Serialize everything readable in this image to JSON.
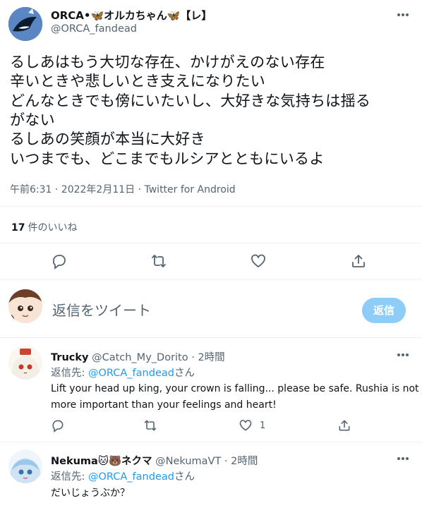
{
  "main_tweet": {
    "author_name": "ORCA•🦋オルカちゃん🦋【レ】",
    "author_handle": "@ORCA_fandead",
    "lines": [
      "るしあはもう大切な存在、かけがえのない存在",
      "辛いときや悲しいとき支えになりたい",
      "どんなときでも傍にいたいし、大好きな気持ちは揺る",
      "がない",
      "るしあの笑顔が本当に大好き",
      "いつまでも、どこまでもルシアとともにいるよ"
    ],
    "timestamp": "午前6:31 · 2022年2月11日 · Twitter for Android",
    "likes_count": "17",
    "likes_label": "件のいいね"
  },
  "actions": {
    "reply_icon": "reply-icon",
    "retweet_icon": "retweet-icon",
    "like_icon": "heart-icon",
    "share_icon": "share-icon"
  },
  "composer": {
    "placeholder": "返信をツイート",
    "button_label": "返信"
  },
  "replies": [
    {
      "name": "Trucky",
      "handle": "@Catch_My_Dorito",
      "time": "· 2時間",
      "reply_to_prefix": "返信先: ",
      "reply_to_handle": "@ORCA_fandead",
      "reply_to_suffix": "さん",
      "text_lines": [
        "Lift your head up king, your crown is falling... please be safe. Rushia is not",
        "more important than your feelings and heart!"
      ],
      "like_count": "1"
    },
    {
      "name": "Nekuma🐱🐻ネクマ",
      "handle": "@NekumaVT",
      "time": "· 2時間",
      "reply_to_prefix": "返信先: ",
      "reply_to_handle": "@ORCA_fandead",
      "reply_to_suffix": "さん",
      "text_lines": [
        "だいじょうぶか？"
      ]
    }
  ],
  "colors": {
    "accent": "#1d9bf0",
    "reply_button_disabled": "#8ecdf8",
    "muted_text": "#536471",
    "divider": "#eff3f4"
  }
}
